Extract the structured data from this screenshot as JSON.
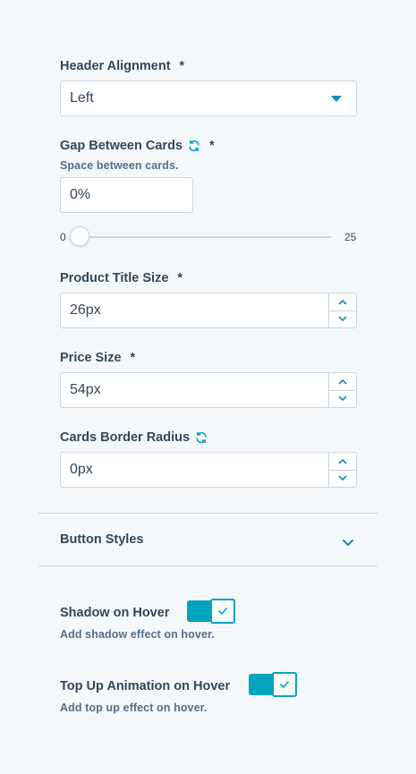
{
  "header_alignment": {
    "label": "Header Alignment",
    "required": "*",
    "value": "Left"
  },
  "gap_between_cards": {
    "label": "Gap Between Cards",
    "required": "*",
    "help": "Space between cards.",
    "value": "0%",
    "slider": {
      "min": "0",
      "max": "25",
      "level": 0
    }
  },
  "product_title_size": {
    "label": "Product Title Size",
    "required": "*",
    "value": "26px"
  },
  "price_size": {
    "label": "Price Size",
    "required": "*",
    "value": "54px"
  },
  "cards_border_radius": {
    "label": "Cards Border Radius",
    "value": "0px"
  },
  "button_styles": {
    "label": "Button Styles"
  },
  "shadow_on_hover": {
    "label": "Shadow on Hover",
    "help": "Add shadow effect on hover.",
    "enabled": true
  },
  "top_up_animation": {
    "label": "Top Up Animation on Hover",
    "help": "Add top up effect on hover.",
    "enabled": true
  },
  "colors": {
    "accent": "#00a4bd",
    "link": "#0091ae",
    "text": "#33475b",
    "border": "#cbd6e2",
    "background": "#f5f8fa"
  },
  "icons": {
    "sync": "sync-icon",
    "caret": "caret-down-icon",
    "chevron": "chevron-down-icon",
    "check": "check-icon"
  }
}
